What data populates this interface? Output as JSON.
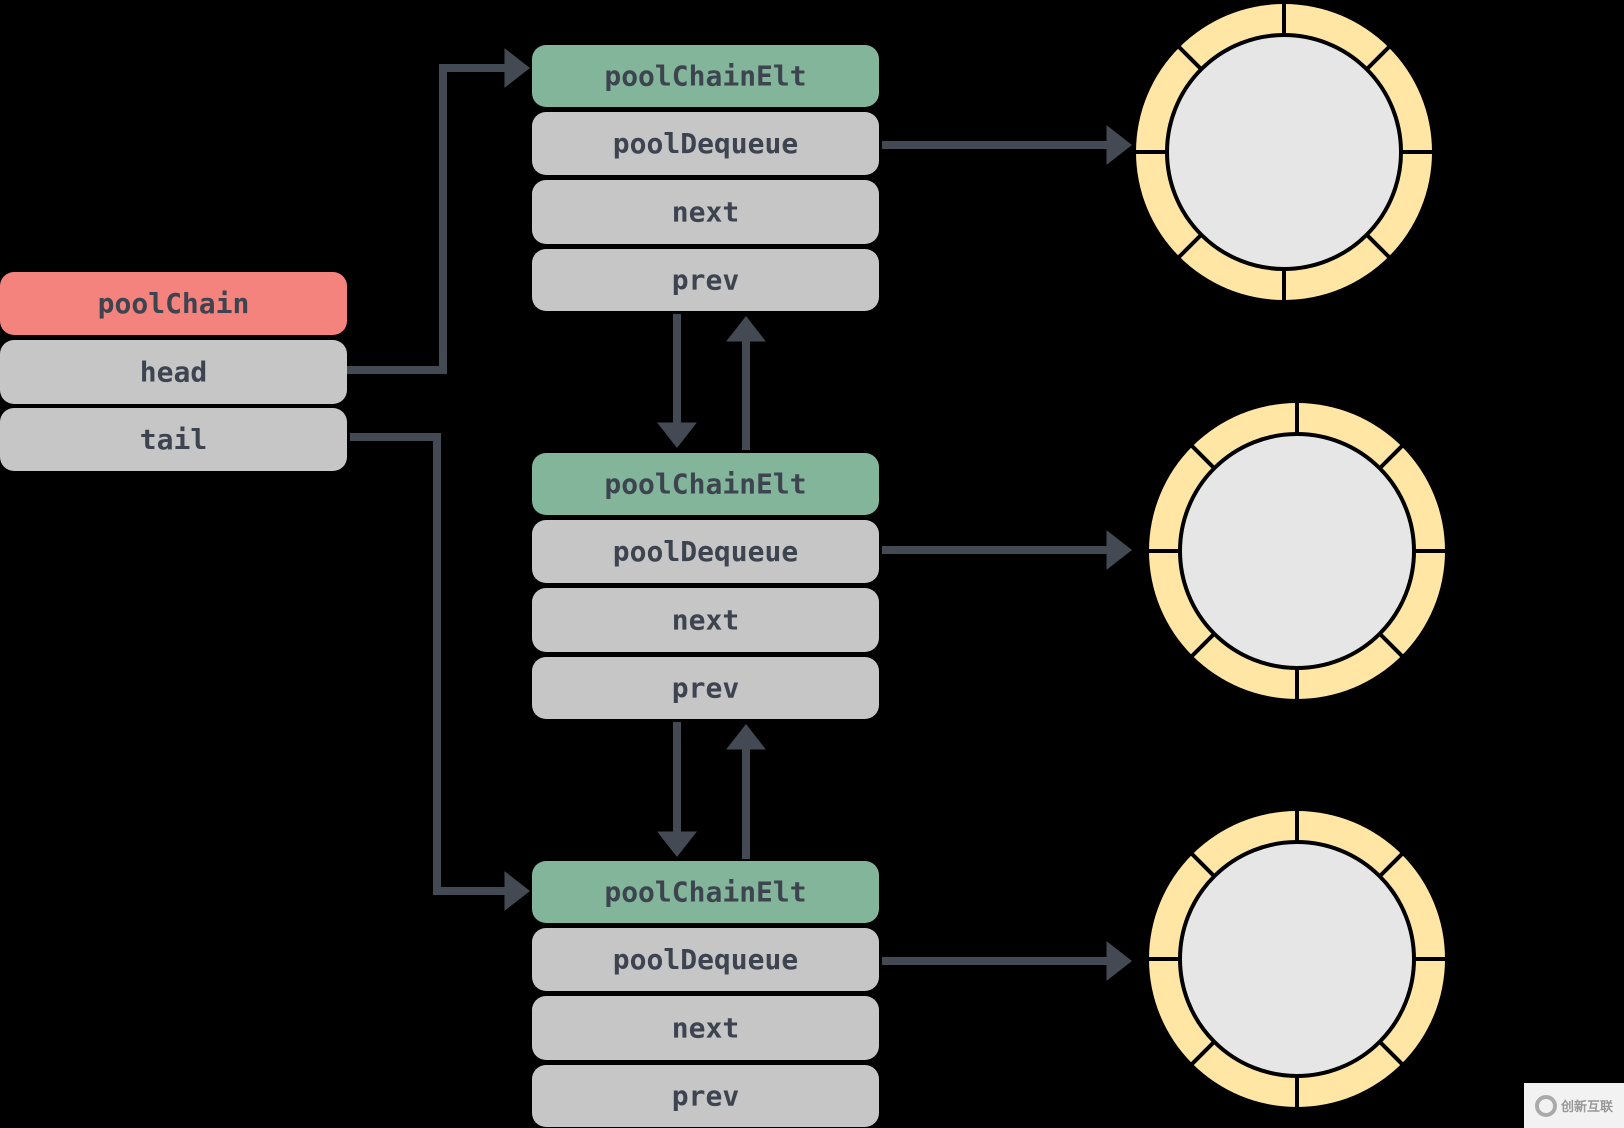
{
  "colors": {
    "background": "#000000",
    "header_root": "#f4827d",
    "header_elt": "#82b59a",
    "field": "#c6c6c6",
    "arrow": "#434a54",
    "ring": "#ffe6a5",
    "ring_inner": "#e6e6e6",
    "text": "#3d4450"
  },
  "root": {
    "title": "poolChain",
    "fields": [
      "head",
      "tail"
    ]
  },
  "elements": [
    {
      "title": "poolChainElt",
      "fields": [
        "poolDequeue",
        "next",
        "prev"
      ]
    },
    {
      "title": "poolChainElt",
      "fields": [
        "poolDequeue",
        "next",
        "prev"
      ]
    },
    {
      "title": "poolChainElt",
      "fields": [
        "poolDequeue",
        "next",
        "prev"
      ]
    }
  ],
  "ring_segments": 8,
  "watermark": {
    "text": "创新互联"
  }
}
